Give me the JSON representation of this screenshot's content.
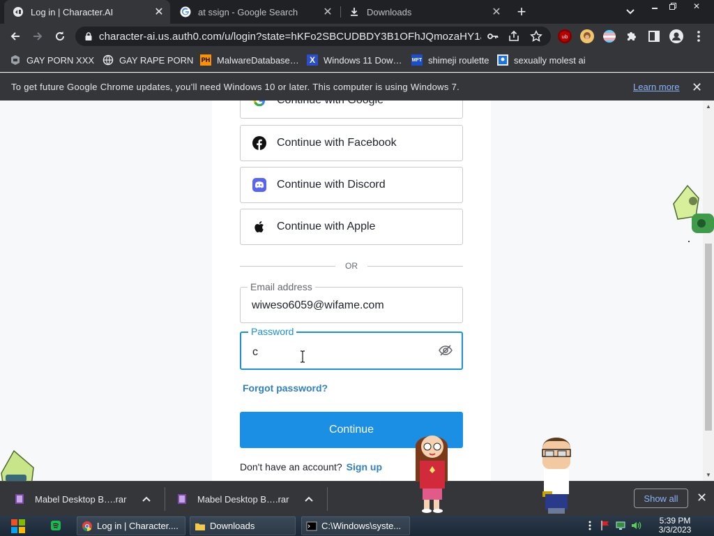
{
  "tabs": [
    {
      "title": "Log in | Character.AI",
      "icon": "character-ai-icon",
      "active": true
    },
    {
      "title": "at ssign - Google Search",
      "icon": "google-icon",
      "active": false
    },
    {
      "title": "Downloads",
      "icon": "download-icon",
      "active": false
    }
  ],
  "toolbar": {
    "url": "character-ai.us.auth0.com/u/login?state=hKFo2SBCUDBDY3B1OFhJQmozaHY1aV…"
  },
  "bookmarks": [
    {
      "label": "GAY PORN XXX",
      "icon": "site-icon"
    },
    {
      "label": "GAY RAPE PORN",
      "icon": "globe-icon"
    },
    {
      "label": "MalwareDatabase…",
      "icon": "ph-icon"
    },
    {
      "label": "Windows 11 Dow…",
      "icon": "x-icon"
    },
    {
      "label": "shimeji roulette",
      "icon": "mft-icon"
    },
    {
      "label": "sexually molest ai",
      "icon": "puzzle-site-icon"
    }
  ],
  "infobar": {
    "message": "To get future Google Chrome updates, you'll need Windows 10 or later. This computer is using Windows 7.",
    "link": "Learn more"
  },
  "login": {
    "google": "Continue with Google",
    "facebook": "Continue with Facebook",
    "discord": "Continue with Discord",
    "apple": "Continue with Apple",
    "or": "OR",
    "email_label": "Email address",
    "email_value": "wiweso6059@wifame.com",
    "password_label": "Password",
    "password_value": "c",
    "forgot": "Forgot password?",
    "continue": "Continue",
    "no_account": "Don't have an account?",
    "signup": "Sign up"
  },
  "downloads": [
    {
      "name": "Mabel Desktop B….rar"
    },
    {
      "name": "Mabel Desktop B….rar"
    }
  ],
  "shelf": {
    "show_all": "Show all"
  },
  "taskbar": {
    "items": [
      {
        "label": "Log in | Character...."
      },
      {
        "label": "Downloads"
      },
      {
        "label": "C:\\Windows\\syste..."
      }
    ],
    "time": "5:39 PM",
    "date": "3/3/2023"
  },
  "colors": {
    "accent": "#1a8fe3",
    "link": "#2f7fc1",
    "chrome_dark": "#35363a"
  }
}
